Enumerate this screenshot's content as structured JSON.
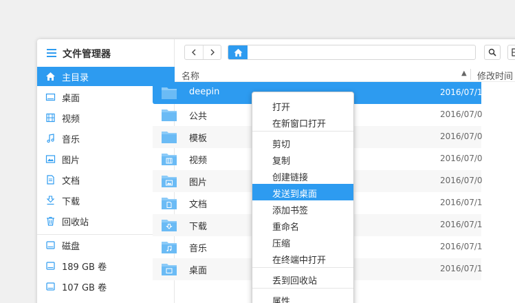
{
  "app": {
    "title": "文件管理器"
  },
  "sidebar": {
    "items": [
      {
        "label": "主目录",
        "icon": "home-icon",
        "active": true
      },
      {
        "label": "桌面",
        "icon": "desktop-icon"
      },
      {
        "label": "视频",
        "icon": "video-icon"
      },
      {
        "label": "音乐",
        "icon": "music-icon"
      },
      {
        "label": "图片",
        "icon": "picture-icon"
      },
      {
        "label": "文档",
        "icon": "document-icon"
      },
      {
        "label": "下载",
        "icon": "download-icon"
      },
      {
        "label": "回收站",
        "icon": "trash-icon"
      },
      {
        "label": "磁盘",
        "icon": "disk-icon"
      },
      {
        "label": "189 GB 卷",
        "icon": "disk-icon"
      },
      {
        "label": "107 GB 卷",
        "icon": "disk-icon"
      }
    ]
  },
  "header": {
    "name": "名称",
    "modified": "修改时间"
  },
  "files": [
    {
      "name": "deepin",
      "date": "2016/07/1",
      "icon": "folder-icon",
      "selected": true
    },
    {
      "name": "公共",
      "date": "2016/07/0",
      "icon": "folder-icon"
    },
    {
      "name": "模板",
      "date": "2016/07/0",
      "icon": "folder-icon"
    },
    {
      "name": "视频",
      "date": "2016/07/0",
      "icon": "folder-video-icon"
    },
    {
      "name": "图片",
      "date": "2016/07/0",
      "icon": "folder-picture-icon"
    },
    {
      "name": "文档",
      "date": "2016/07/1",
      "icon": "folder-document-icon"
    },
    {
      "name": "下载",
      "date": "2016/07/1",
      "icon": "folder-download-icon"
    },
    {
      "name": "音乐",
      "date": "2016/07/1",
      "icon": "folder-music-icon"
    },
    {
      "name": "桌面",
      "date": "2016/07/1",
      "icon": "folder-desktop-icon"
    }
  ],
  "context_menu": {
    "items": [
      "打开",
      "在新窗口打开",
      "剪切",
      "复制",
      "创建链接",
      "发送到桌面",
      "添加书签",
      "重命名",
      "压缩",
      "在终端中打开",
      "丢到回收站",
      "属性"
    ],
    "highlighted": "发送到桌面"
  },
  "colors": {
    "accent": "#2d9bf0",
    "folder": "#6bbbf5"
  }
}
